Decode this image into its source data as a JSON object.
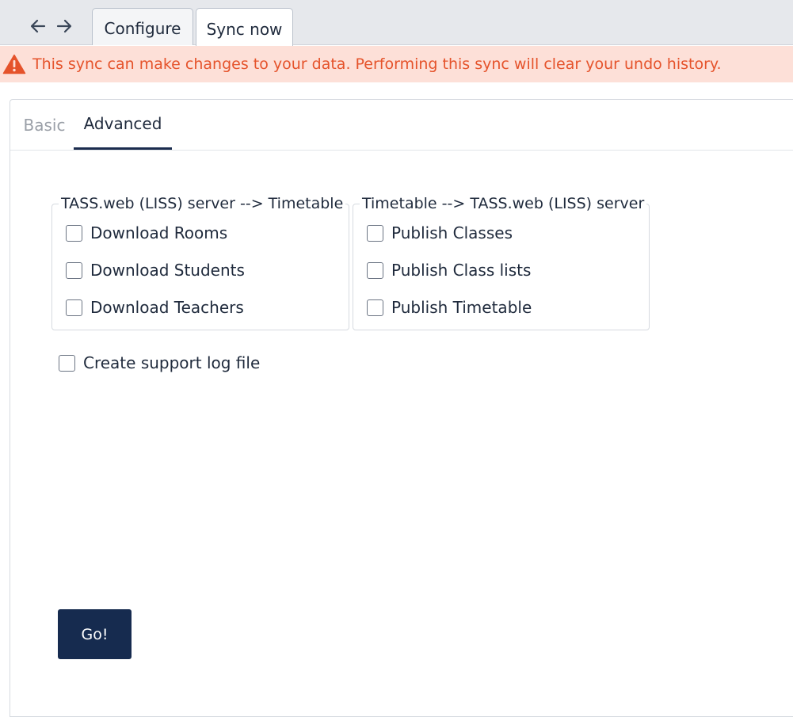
{
  "nav": {
    "back_icon": "arrow-left-icon",
    "forward_icon": "arrow-right-icon"
  },
  "tabs": [
    {
      "label": "Configure"
    },
    {
      "label": "Sync now",
      "active": true
    }
  ],
  "warning": {
    "icon": "warning-triangle-icon",
    "text": "This sync can make changes to your data. Performing this sync will clear your undo history.",
    "color": "#e5532b",
    "background": "#fde0d8"
  },
  "subtabs": [
    {
      "label": "Basic"
    },
    {
      "label": "Advanced",
      "active": true
    }
  ],
  "download_group": {
    "legend": "TASS.web (LISS) server --> Timetable",
    "options": [
      {
        "label": "Download Rooms",
        "checked": false
      },
      {
        "label": "Download Students",
        "checked": false
      },
      {
        "label": "Download Teachers",
        "checked": false
      }
    ]
  },
  "publish_group": {
    "legend": "Timetable --> TASS.web (LISS) server",
    "options": [
      {
        "label": "Publish Classes",
        "checked": false
      },
      {
        "label": "Publish Class lists",
        "checked": false
      },
      {
        "label": "Publish Timetable",
        "checked": false
      }
    ]
  },
  "support_log": {
    "label": "Create support log file",
    "checked": false
  },
  "go_button": {
    "label": "Go!",
    "color": "#162b4f"
  }
}
